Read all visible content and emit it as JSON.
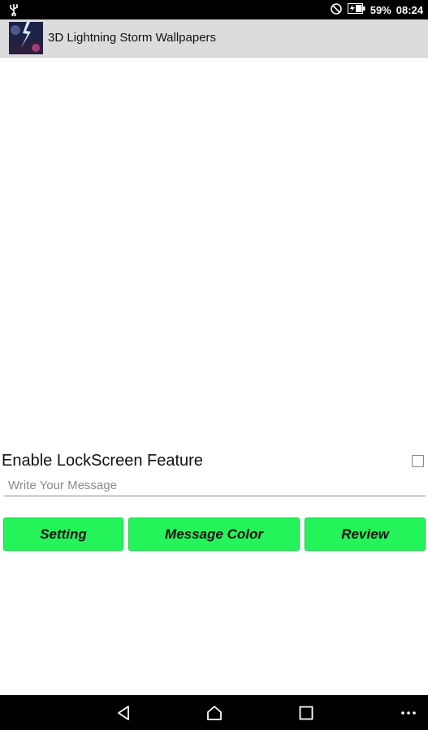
{
  "status_bar": {
    "battery_percent": "59%",
    "time": "08:24",
    "icons": [
      "usb-icon",
      "do-not-disturb-icon",
      "battery-icon"
    ]
  },
  "app_bar": {
    "title": "3D Lightning Storm Wallpapers",
    "app_icon": "app-thumbnail-icon"
  },
  "lockscreen": {
    "label": "Enable LockScreen Feature",
    "checked": false
  },
  "message": {
    "value": "",
    "placeholder": "Write Your Message"
  },
  "buttons": {
    "setting": "Setting",
    "message_color": "Message Color",
    "review": "Review"
  },
  "colors": {
    "button_green": "#24f45a",
    "app_bar": "#dcdcdc"
  },
  "nav_bar": {
    "icons": [
      "back-icon",
      "home-icon",
      "recent-apps-icon",
      "more-icon"
    ]
  }
}
